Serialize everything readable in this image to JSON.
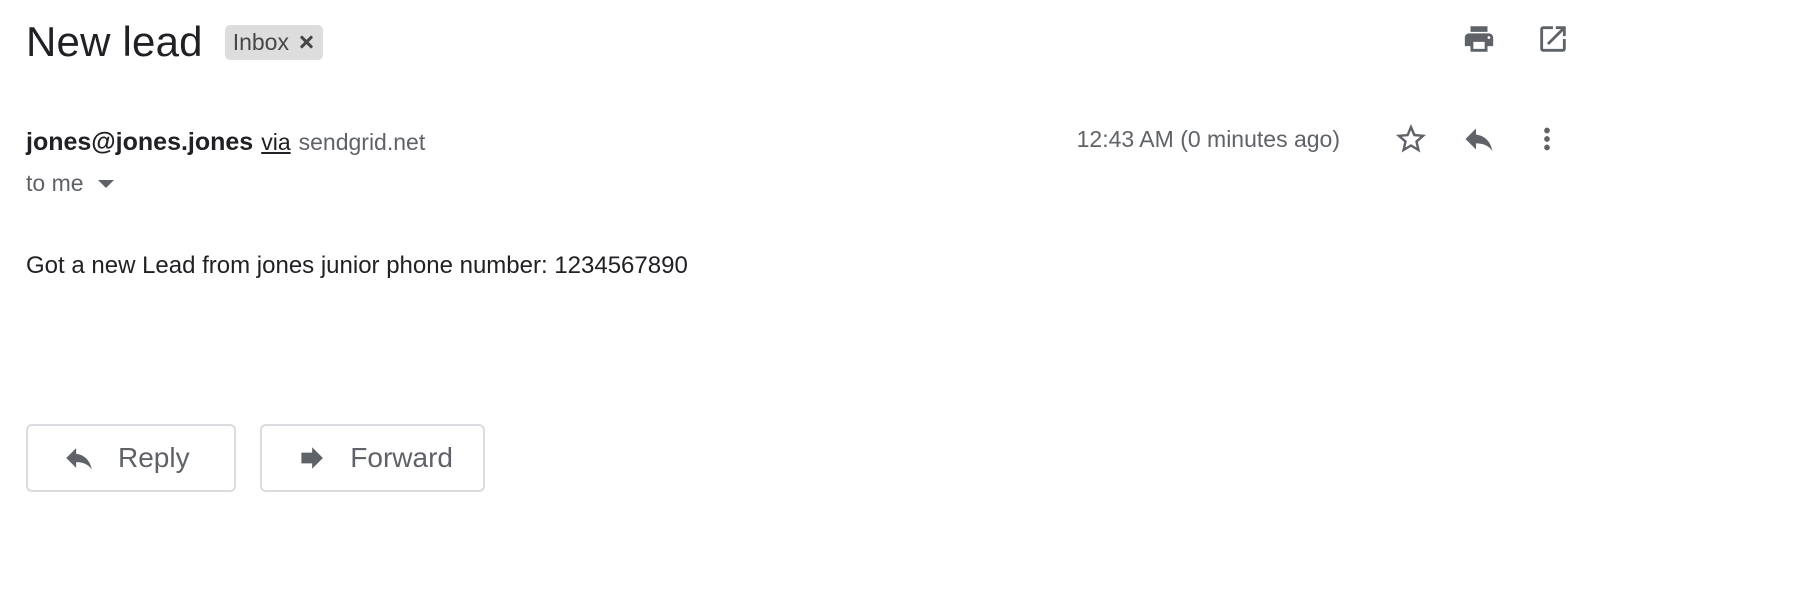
{
  "email": {
    "subject": "New lead",
    "label": "Inbox",
    "sender": "jones@jones.jones",
    "via_label": "via",
    "via_domain": "sendgrid.net",
    "recipient": "to me",
    "timestamp": "12:43 AM (0 minutes ago)",
    "body": "Got a new Lead from jones junior phone number: 1234567890"
  },
  "actions": {
    "reply_label": "Reply",
    "forward_label": "Forward"
  },
  "icons": {
    "top": [
      "print-icon",
      "open-in-new-window-icon"
    ],
    "message": [
      "star-icon",
      "reply-icon",
      "more-vertical-icon"
    ]
  },
  "colors": {
    "text_primary": "#202124",
    "text_secondary": "#5f6368",
    "chip_background": "#dddddd",
    "button_border": "#dadce0"
  }
}
